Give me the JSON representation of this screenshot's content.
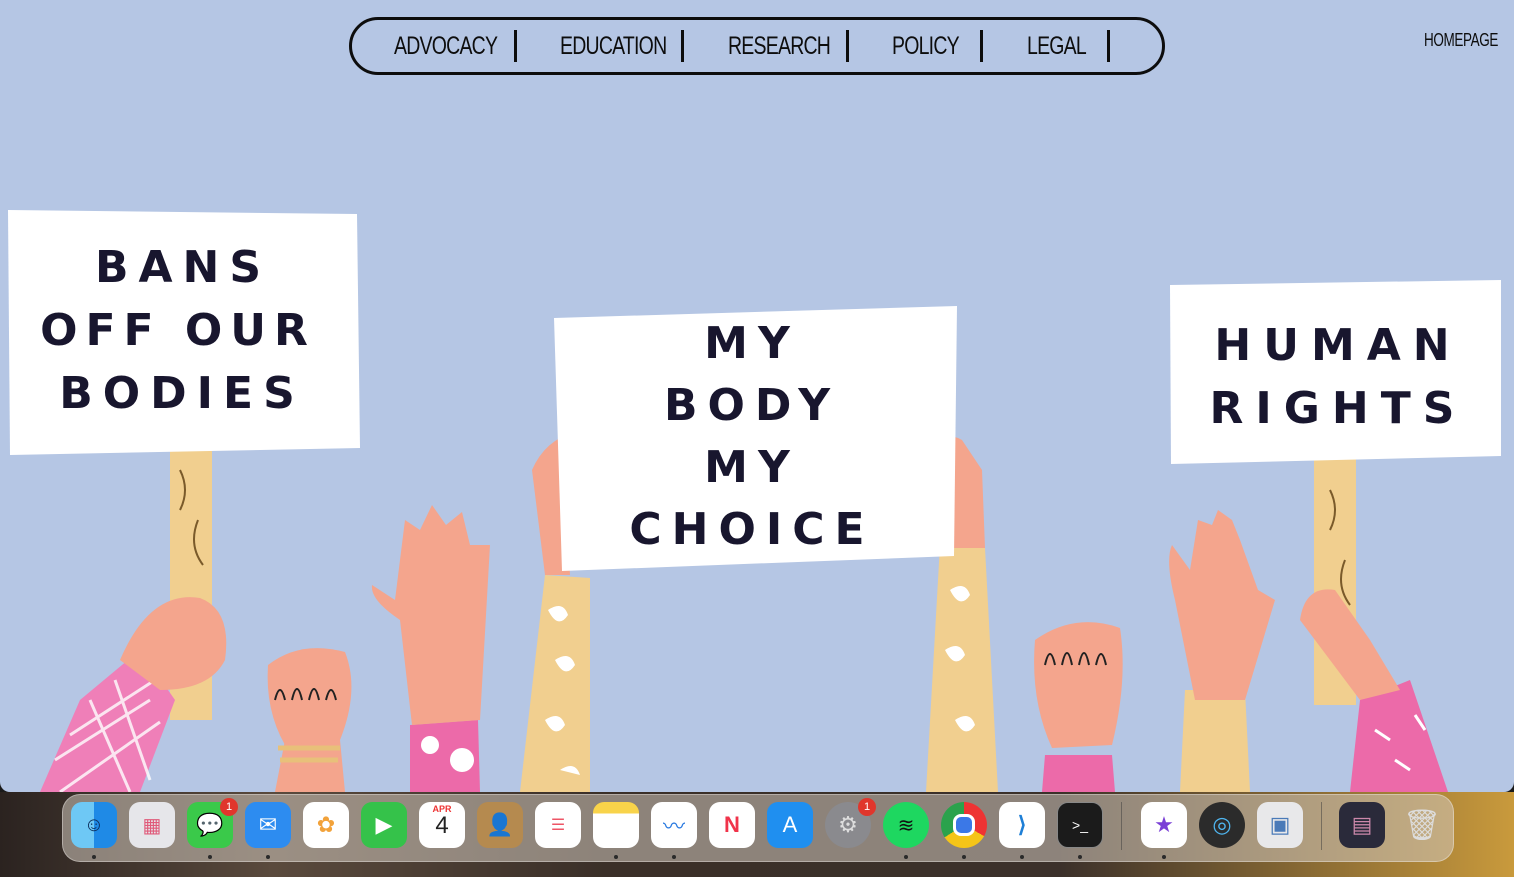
{
  "nav": {
    "items": [
      "ADVOCACY",
      "EDUCATION",
      "RESEARCH",
      "POLICY",
      "LEGAL"
    ],
    "homepage": "HOMEPAGE"
  },
  "signs": {
    "left": [
      "BANS",
      "OFF OUR",
      "BODIES"
    ],
    "center": [
      "MY",
      "BODY",
      "MY",
      "CHOICE"
    ],
    "right": [
      "HUMAN",
      "RIGHTS"
    ]
  },
  "dock": {
    "messages_badge": "1",
    "settings_badge": "1",
    "calendar_month": "APR",
    "calendar_day": "4"
  },
  "colors": {
    "background": "#b5c6e4",
    "ink": "#0d0d0d",
    "sign_text": "#18162e"
  }
}
